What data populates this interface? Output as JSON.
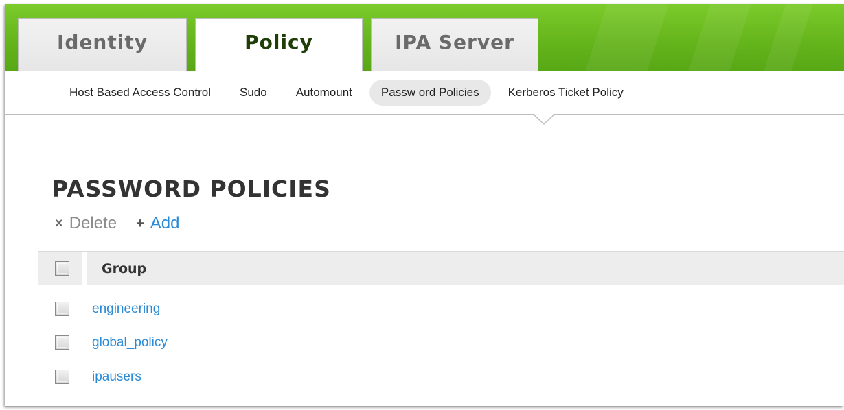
{
  "tabs": [
    {
      "label": "Identity",
      "active": false
    },
    {
      "label": "Policy",
      "active": true
    },
    {
      "label": "IPA Server",
      "active": false
    }
  ],
  "subnav": {
    "items": [
      {
        "label": "Host Based Access Control",
        "selected": false
      },
      {
        "label": "Sudo",
        "selected": false
      },
      {
        "label": "Automount",
        "selected": false
      },
      {
        "label": "Passw ord Policies",
        "selected": true
      },
      {
        "label": "Kerberos Ticket Policy",
        "selected": false
      }
    ]
  },
  "page": {
    "title": "PASSWORD POLICIES",
    "actions": {
      "delete_icon": "×",
      "delete_label": "Delete",
      "add_icon": "+",
      "add_label": "Add"
    }
  },
  "table": {
    "columns": [
      "Group"
    ],
    "rows": [
      {
        "group": "engineering",
        "checked": false
      },
      {
        "group": "global_policy",
        "checked": false
      },
      {
        "group": "ipausers",
        "checked": false
      }
    ]
  },
  "colors": {
    "header_green": "#65b51c",
    "link_blue": "#2a8ad6",
    "active_tab_text": "#1f3d07",
    "inactive_tab_text": "#6a6a6a"
  },
  "icons": {
    "delete": "close-icon",
    "add": "plus-icon",
    "nav_pointer": "caret-down-icon"
  }
}
